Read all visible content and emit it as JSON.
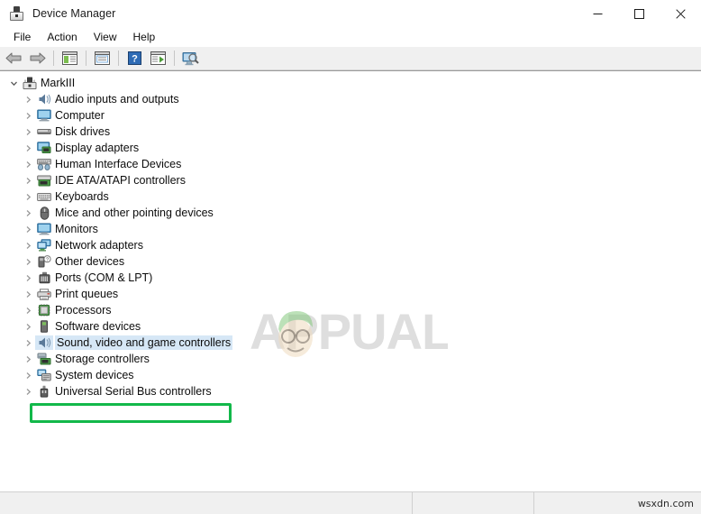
{
  "window": {
    "title": "Device Manager",
    "app_icon": "device-manager-icon",
    "controls": {
      "minimize": "Minimize",
      "maximize": "Maximize",
      "close": "Close"
    }
  },
  "menubar": {
    "items": [
      {
        "label": "File",
        "name": "menu-file"
      },
      {
        "label": "Action",
        "name": "menu-action"
      },
      {
        "label": "View",
        "name": "menu-view"
      },
      {
        "label": "Help",
        "name": "menu-help"
      }
    ]
  },
  "toolbar": {
    "buttons": [
      {
        "name": "back-button",
        "icon": "back-arrow-icon",
        "tooltip": "Back"
      },
      {
        "name": "forward-button",
        "icon": "forward-arrow-icon",
        "tooltip": "Forward"
      },
      {
        "name": "show-hide-console-tree-button",
        "icon": "console-tree-icon",
        "tooltip": "Show/Hide Console Tree"
      },
      {
        "name": "properties-button",
        "icon": "properties-icon",
        "tooltip": "Properties"
      },
      {
        "name": "help-button",
        "icon": "help-question-icon",
        "tooltip": "Help"
      },
      {
        "name": "update-driver-button",
        "icon": "update-driver-icon",
        "tooltip": "Update driver"
      },
      {
        "name": "scan-hardware-changes-button",
        "icon": "scan-monitor-icon",
        "tooltip": "Scan for hardware changes"
      }
    ]
  },
  "tree": {
    "root": {
      "label": "MarkIII",
      "icon": "computer-root-icon",
      "expanded": true
    },
    "items": [
      {
        "label": "Audio inputs and outputs",
        "icon": "speaker-icon",
        "selected": false
      },
      {
        "label": "Computer",
        "icon": "monitor-icon",
        "selected": false
      },
      {
        "label": "Disk drives",
        "icon": "disk-drive-icon",
        "selected": false
      },
      {
        "label": "Display adapters",
        "icon": "display-adapter-icon",
        "selected": false
      },
      {
        "label": "Human Interface Devices",
        "icon": "hid-icon",
        "selected": false
      },
      {
        "label": "IDE ATA/ATAPI controllers",
        "icon": "ide-controller-icon",
        "selected": false
      },
      {
        "label": "Keyboards",
        "icon": "keyboard-icon",
        "selected": false
      },
      {
        "label": "Mice and other pointing devices",
        "icon": "mouse-icon",
        "selected": false
      },
      {
        "label": "Monitors",
        "icon": "monitor-icon",
        "selected": false
      },
      {
        "label": "Network adapters",
        "icon": "network-adapter-icon",
        "selected": false
      },
      {
        "label": "Other devices",
        "icon": "other-device-icon",
        "selected": false
      },
      {
        "label": "Ports (COM & LPT)",
        "icon": "port-icon",
        "selected": false
      },
      {
        "label": "Print queues",
        "icon": "printer-icon",
        "selected": false
      },
      {
        "label": "Processors",
        "icon": "processor-icon",
        "selected": false
      },
      {
        "label": "Software devices",
        "icon": "software-device-icon",
        "selected": false
      },
      {
        "label": "Sound, video and game controllers",
        "icon": "speaker-icon",
        "selected": true
      },
      {
        "label": "Storage controllers",
        "icon": "storage-controller-icon",
        "selected": false
      },
      {
        "label": "System devices",
        "icon": "system-device-icon",
        "selected": false
      },
      {
        "label": "Universal Serial Bus controllers",
        "icon": "usb-icon",
        "selected": false
      }
    ]
  },
  "annotation": {
    "highlight_color": "#12b84a",
    "target_label": "Sound, video and game controllers"
  },
  "watermark": {
    "text": "APPUALS",
    "color": "#d9d9d9"
  },
  "statusbar": {
    "main_text": "",
    "mid_text": "",
    "right_text": "wsxdn.com"
  }
}
